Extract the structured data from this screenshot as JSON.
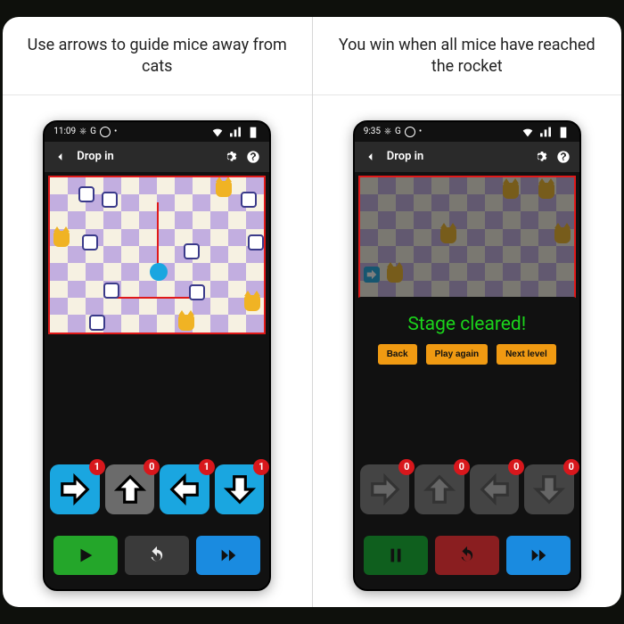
{
  "captions": {
    "left": "Use arrows to guide mice away from cats",
    "right": "You win when all mice have reached the rocket"
  },
  "status": {
    "time_left": "11:09",
    "time_right": "9:35",
    "indicators": "G ⊙ •"
  },
  "title": {
    "back": "←",
    "label": "Drop in",
    "settings": "⚙",
    "help": "?"
  },
  "arrows_left": {
    "right": {
      "count": "1",
      "active": true
    },
    "up": {
      "count": "0",
      "active": false
    },
    "left": {
      "count": "1",
      "active": true
    },
    "down": {
      "count": "1",
      "active": true
    }
  },
  "arrows_right": {
    "right": {
      "count": "0"
    },
    "up": {
      "count": "0"
    },
    "left": {
      "count": "0"
    },
    "down": {
      "count": "0"
    }
  },
  "cleared": {
    "message": "Stage cleared!",
    "back": "Back",
    "play_again": "Play again",
    "next": "Next level"
  },
  "bottom": {
    "play": "play",
    "pause": "pause",
    "reset": "reset",
    "ff": "fast-forward"
  }
}
